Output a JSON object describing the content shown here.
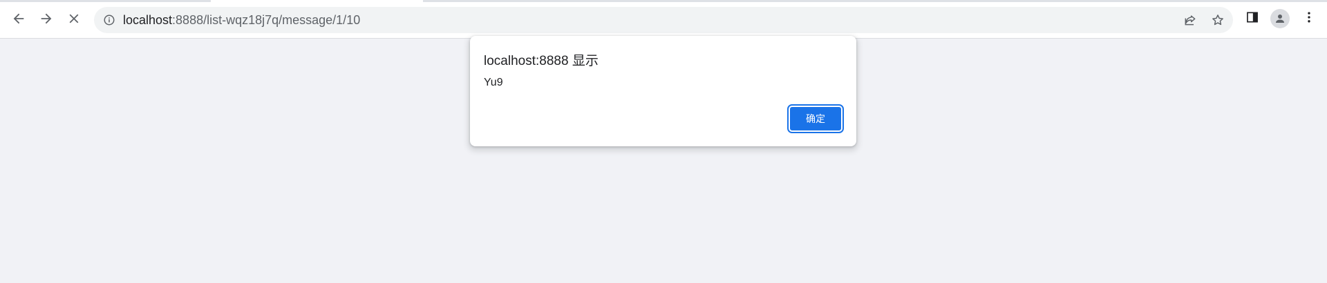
{
  "browser": {
    "url_host": "localhost",
    "url_rest": ":8888/list-wqz18j7q/message/1/10",
    "icons": {
      "back": "back-arrow-icon",
      "forward": "forward-arrow-icon",
      "stop": "close-icon",
      "site_info": "info-icon",
      "share": "share-icon",
      "bookmark": "star-icon",
      "side_panel": "side-panel-icon",
      "profile": "profile-icon",
      "menu": "kebab-menu-icon"
    }
  },
  "dialog": {
    "title": "localhost:8888 显示",
    "message": "Yu9",
    "ok_label": "确定"
  },
  "colors": {
    "page_background": "#f1f2f6",
    "accent": "#1a73e8"
  }
}
